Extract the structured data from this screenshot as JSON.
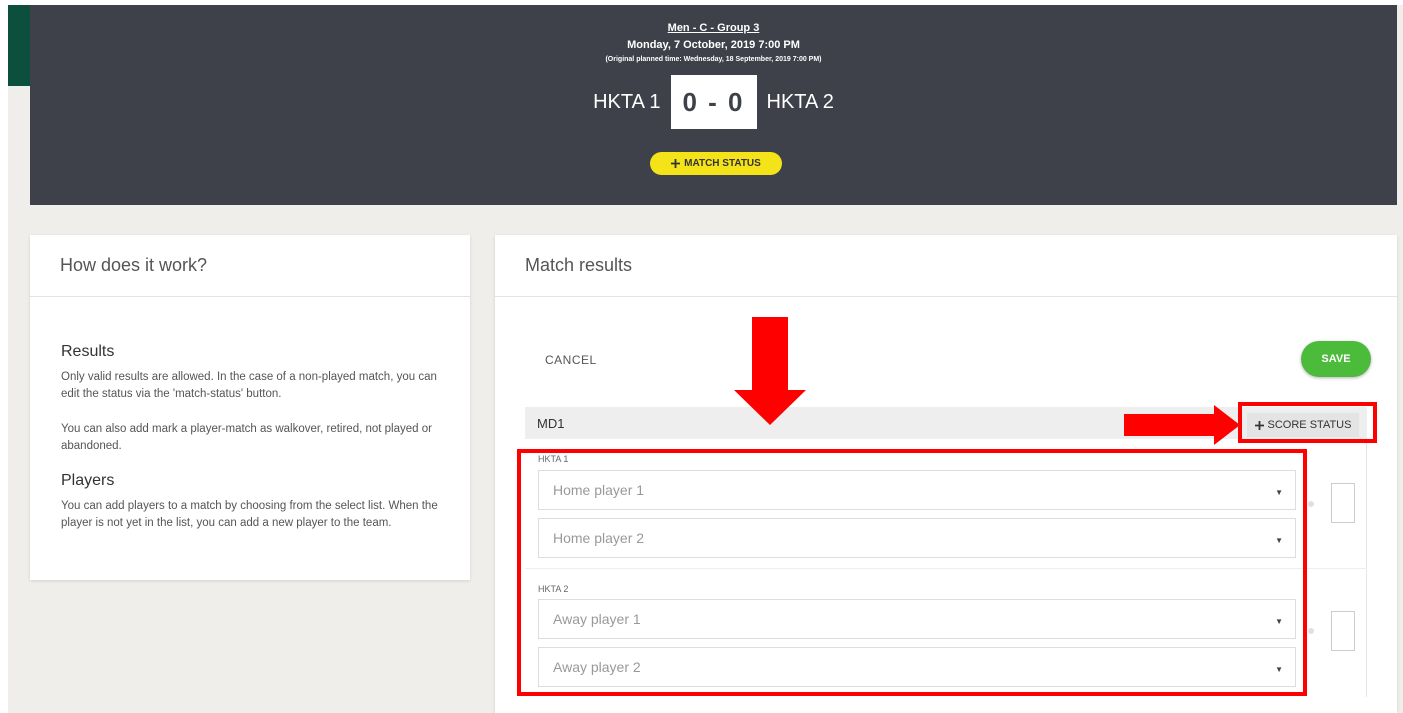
{
  "header": {
    "round": "Men - C - Group 3",
    "date": "Monday, 7 October, 2019 7:00 PM",
    "original_time": "(Original planned time: Wednesday, 18 September, 2019 7:00 PM)",
    "home_team": "HKTA 1",
    "away_team": "HKTA 2",
    "score": "0 - 0",
    "match_status_label": "MATCH STATUS"
  },
  "help": {
    "title": "How does it work?",
    "results_heading": "Results",
    "results_text": "Only valid results are allowed. In the case of a non-played match, you can edit the status via the 'match-status' button.",
    "results_text2": "You can also add mark a player-match as walkover, retired, not played or abandoned.",
    "players_heading": "Players",
    "players_text": "You can add players to a match by choosing from the select list. When the player is not yet in the list, you can add a new player to the team."
  },
  "results": {
    "title": "Match results",
    "cancel_label": "CANCEL",
    "save_label": "SAVE",
    "match_code": "MD1",
    "score_status_label": "SCORE STATUS",
    "home_team": "HKTA 1",
    "away_team": "HKTA 2",
    "home_player1_placeholder": "Home player 1",
    "home_player2_placeholder": "Home player 2",
    "away_player1_placeholder": "Away player 1",
    "away_player2_placeholder": "Away player 2"
  },
  "icons": {
    "plus": "plus-icon",
    "caret": "caret-down-icon"
  },
  "colors": {
    "header_bg": "#3e4149",
    "accent_yellow": "#f5e31a",
    "save_green": "#4cbb3c",
    "annotation_red": "#ff0000",
    "brand_green": "#0b4f3c"
  }
}
